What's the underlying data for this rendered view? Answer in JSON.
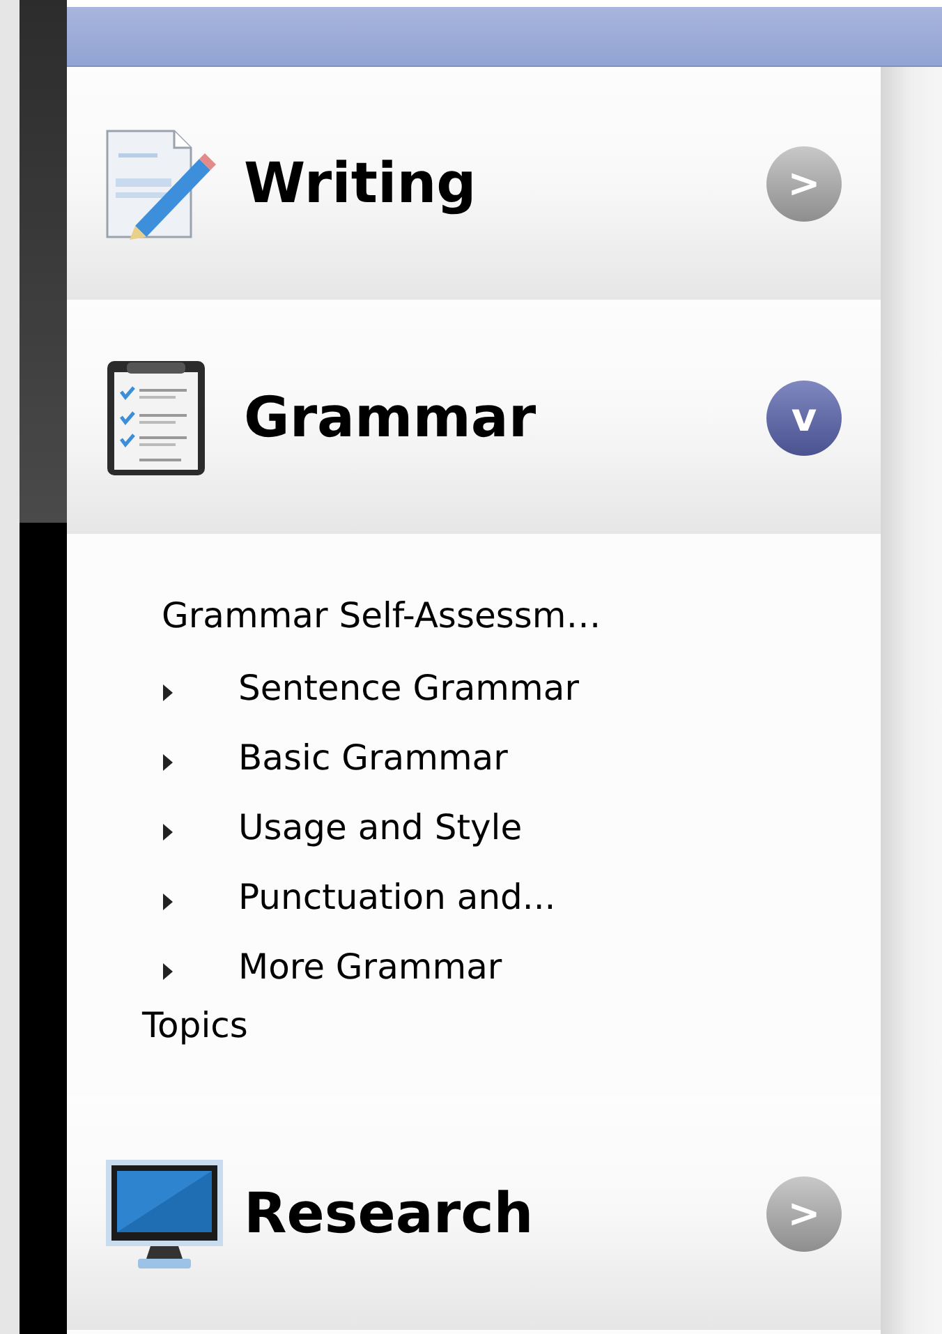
{
  "sections": [
    {
      "title": "Writing",
      "expanded": false,
      "badge": ">"
    },
    {
      "title": "Grammar",
      "expanded": true,
      "badge": "v",
      "items": [
        {
          "kind": "link",
          "label": "Grammar Self-Assessm…"
        },
        {
          "kind": "folder",
          "label": "Sentence Grammar"
        },
        {
          "kind": "folder",
          "label": "Basic Grammar"
        },
        {
          "kind": "folder",
          "label": "Usage and Style"
        },
        {
          "kind": "folder",
          "label": "Punctuation and..."
        },
        {
          "kind": "folder",
          "label": "More Grammar Topics"
        }
      ]
    },
    {
      "title": "Research",
      "expanded": false,
      "badge": ">"
    }
  ]
}
